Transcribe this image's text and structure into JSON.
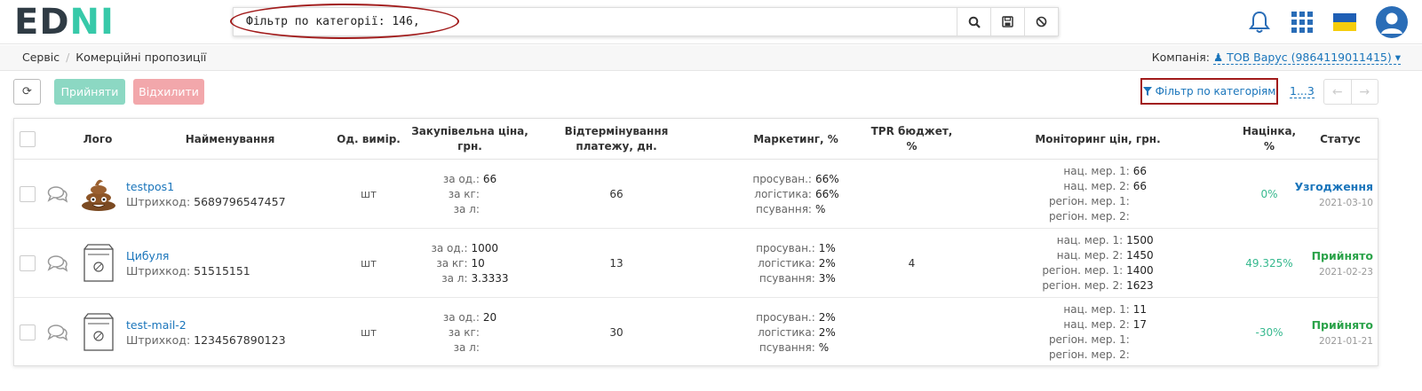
{
  "logo": {
    "text_a": "ED",
    "text_b": "N",
    "text_c": "I"
  },
  "search": {
    "value": "Фільтр по категорії: 146,"
  },
  "icons": {
    "search": "search-icon",
    "save": "save-icon",
    "clear": "ban-icon",
    "bell": "bell-icon",
    "apps": "apps-grid-icon",
    "flag": "ukraine-flag-icon",
    "user": "user-avatar-icon"
  },
  "breadcrumb": {
    "items": [
      "Сервіс",
      "Комерційні пропозиції"
    ]
  },
  "company": {
    "label": "Компанія:",
    "value": "ТОВ Варус (9864119011415)"
  },
  "toolbar": {
    "accept": "Прийняти",
    "reject": "Відхилити",
    "filter": "Фільтр по категоріям",
    "pages": "1...3"
  },
  "table": {
    "headers": {
      "logo": "Лого",
      "name": "Найменування",
      "unit": "Од. вимір.",
      "price": "Закупівельна ціна, грн.",
      "delay": "Відтермінування платежу, дн.",
      "marketing": "Маркетинг, %",
      "tpr": "TPR бюджет, %",
      "monitoring": "Моніторинг цін, грн.",
      "markup": "Націнка, %",
      "status": "Статус"
    },
    "rows": [
      {
        "name": "testpos1",
        "barcode_label": "Штрихкод:",
        "barcode": "5689796547457",
        "unit": "шт",
        "price": [
          [
            "за од.:",
            "66"
          ],
          [
            "за кг:",
            ""
          ],
          [
            "за л:",
            ""
          ]
        ],
        "delay": "66",
        "marketing": [
          [
            "просуван.:",
            "66%"
          ],
          [
            "логістика:",
            "66%"
          ],
          [
            "псування:",
            "%"
          ]
        ],
        "tpr": "",
        "monitoring": [
          [
            "нац. мер. 1:",
            "66"
          ],
          [
            "нац. мер. 2:",
            "66"
          ],
          [
            "регіон. мер. 1:",
            ""
          ],
          [
            "регіон. мер. 2:",
            ""
          ]
        ],
        "markup": "0%",
        "status": "Узгодження",
        "date": "2021-03-10"
      },
      {
        "name": "Цибуля",
        "barcode_label": "Штрихкод:",
        "barcode": "51515151",
        "unit": "шт",
        "price": [
          [
            "за од.:",
            "1000"
          ],
          [
            "за кг:",
            "10"
          ],
          [
            "за л:",
            "3.3333"
          ]
        ],
        "delay": "13",
        "marketing": [
          [
            "просуван.:",
            "1%"
          ],
          [
            "логістика:",
            "2%"
          ],
          [
            "псування:",
            "3%"
          ]
        ],
        "tpr": "4",
        "monitoring": [
          [
            "нац. мер. 1:",
            "1500"
          ],
          [
            "нац. мер. 2:",
            "1450"
          ],
          [
            "регіон. мер. 1:",
            "1400"
          ],
          [
            "регіон. мер. 2:",
            "1623"
          ]
        ],
        "markup": "49.325%",
        "status": "Прийнято",
        "date": "2021-02-23"
      },
      {
        "name": "test-mail-2",
        "barcode_label": "Штрихкод:",
        "barcode": "1234567890123",
        "unit": "шт",
        "price": [
          [
            "за од.:",
            "20"
          ],
          [
            "за кг:",
            ""
          ],
          [
            "за л:",
            ""
          ]
        ],
        "delay": "30",
        "marketing": [
          [
            "просуван.:",
            "2%"
          ],
          [
            "логістика:",
            "2%"
          ],
          [
            "псування:",
            "%"
          ]
        ],
        "tpr": "",
        "monitoring": [
          [
            "нац. мер. 1:",
            "11"
          ],
          [
            "нац. мер. 2:",
            "17"
          ],
          [
            "регіон. мер. 1:",
            ""
          ],
          [
            "регіон. мер. 2:",
            ""
          ]
        ],
        "markup": "-30%",
        "status": "Прийнято",
        "date": "2021-01-21"
      }
    ]
  },
  "colors": {
    "brand_dark": "#2f3b44",
    "brand_accent": "#37c9a9",
    "link": "#1a75bb",
    "accept": "#8cd8c3",
    "reject": "#f2a7ab",
    "highlight": "#a11b1b"
  }
}
